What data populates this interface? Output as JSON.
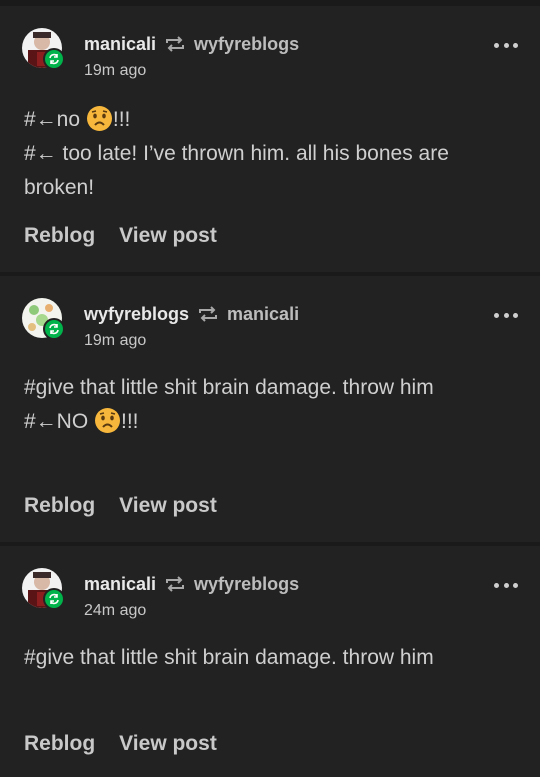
{
  "posts": [
    {
      "author": "manicali",
      "reblogged_from": "wyfyreblogs",
      "time": "19m ago",
      "lines": [
        "#←no ",
        "#← too late! I’ve thrown him. all his bones are broken!"
      ],
      "line1_suffix": "!!!",
      "avatar": "manicali-avatar"
    },
    {
      "author": "wyfyreblogs",
      "reblogged_from": "manicali",
      "time": "19m ago",
      "lines": [
        "#give that little shit brain damage. throw him",
        "#←NO "
      ],
      "line2_suffix": "!!!",
      "avatar": "wyfyreblogs-avatar"
    },
    {
      "author": "manicali",
      "reblogged_from": "wyfyreblogs",
      "time": "24m ago",
      "lines": [
        "#give that little shit brain damage. throw him"
      ],
      "avatar": "manicali-avatar"
    }
  ],
  "actions": {
    "reblog": "Reblog",
    "view_post": "View post"
  },
  "colors": {
    "background": "#1a1a1a",
    "card": "#222222",
    "badge": "#00b34a",
    "emoji": "#f6b73c"
  },
  "icons": {
    "reblog": "reblog-icon",
    "more": "more-dots-icon",
    "badge": "reblog-badge-icon",
    "emoji": "worried-face-emoji"
  }
}
